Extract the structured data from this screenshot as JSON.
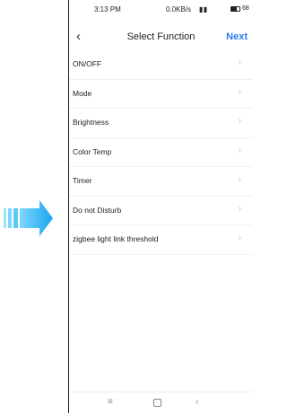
{
  "status": {
    "time": "3:13 PM",
    "network_speed": "0.0KB/s",
    "icons": "⏰ ✉ ὏6",
    "battery": "68",
    "battery_level_percent": 68
  },
  "header": {
    "back_icon": "‹",
    "title": "Select Function",
    "next_label": "Next"
  },
  "functions": [
    {
      "label": "ON/OFF"
    },
    {
      "label": "Mode"
    },
    {
      "label": "Brightness"
    },
    {
      "label": "Color Temp"
    },
    {
      "label": "Timer"
    },
    {
      "label": "Do not Disturb"
    },
    {
      "label": "zigbee light link threshold"
    }
  ],
  "chevron": "›",
  "navbar": {
    "menu_icon": "≡",
    "back_icon": "‹"
  },
  "colors": {
    "accent": "#2e7bf0",
    "arrow": "#27b3f0"
  }
}
